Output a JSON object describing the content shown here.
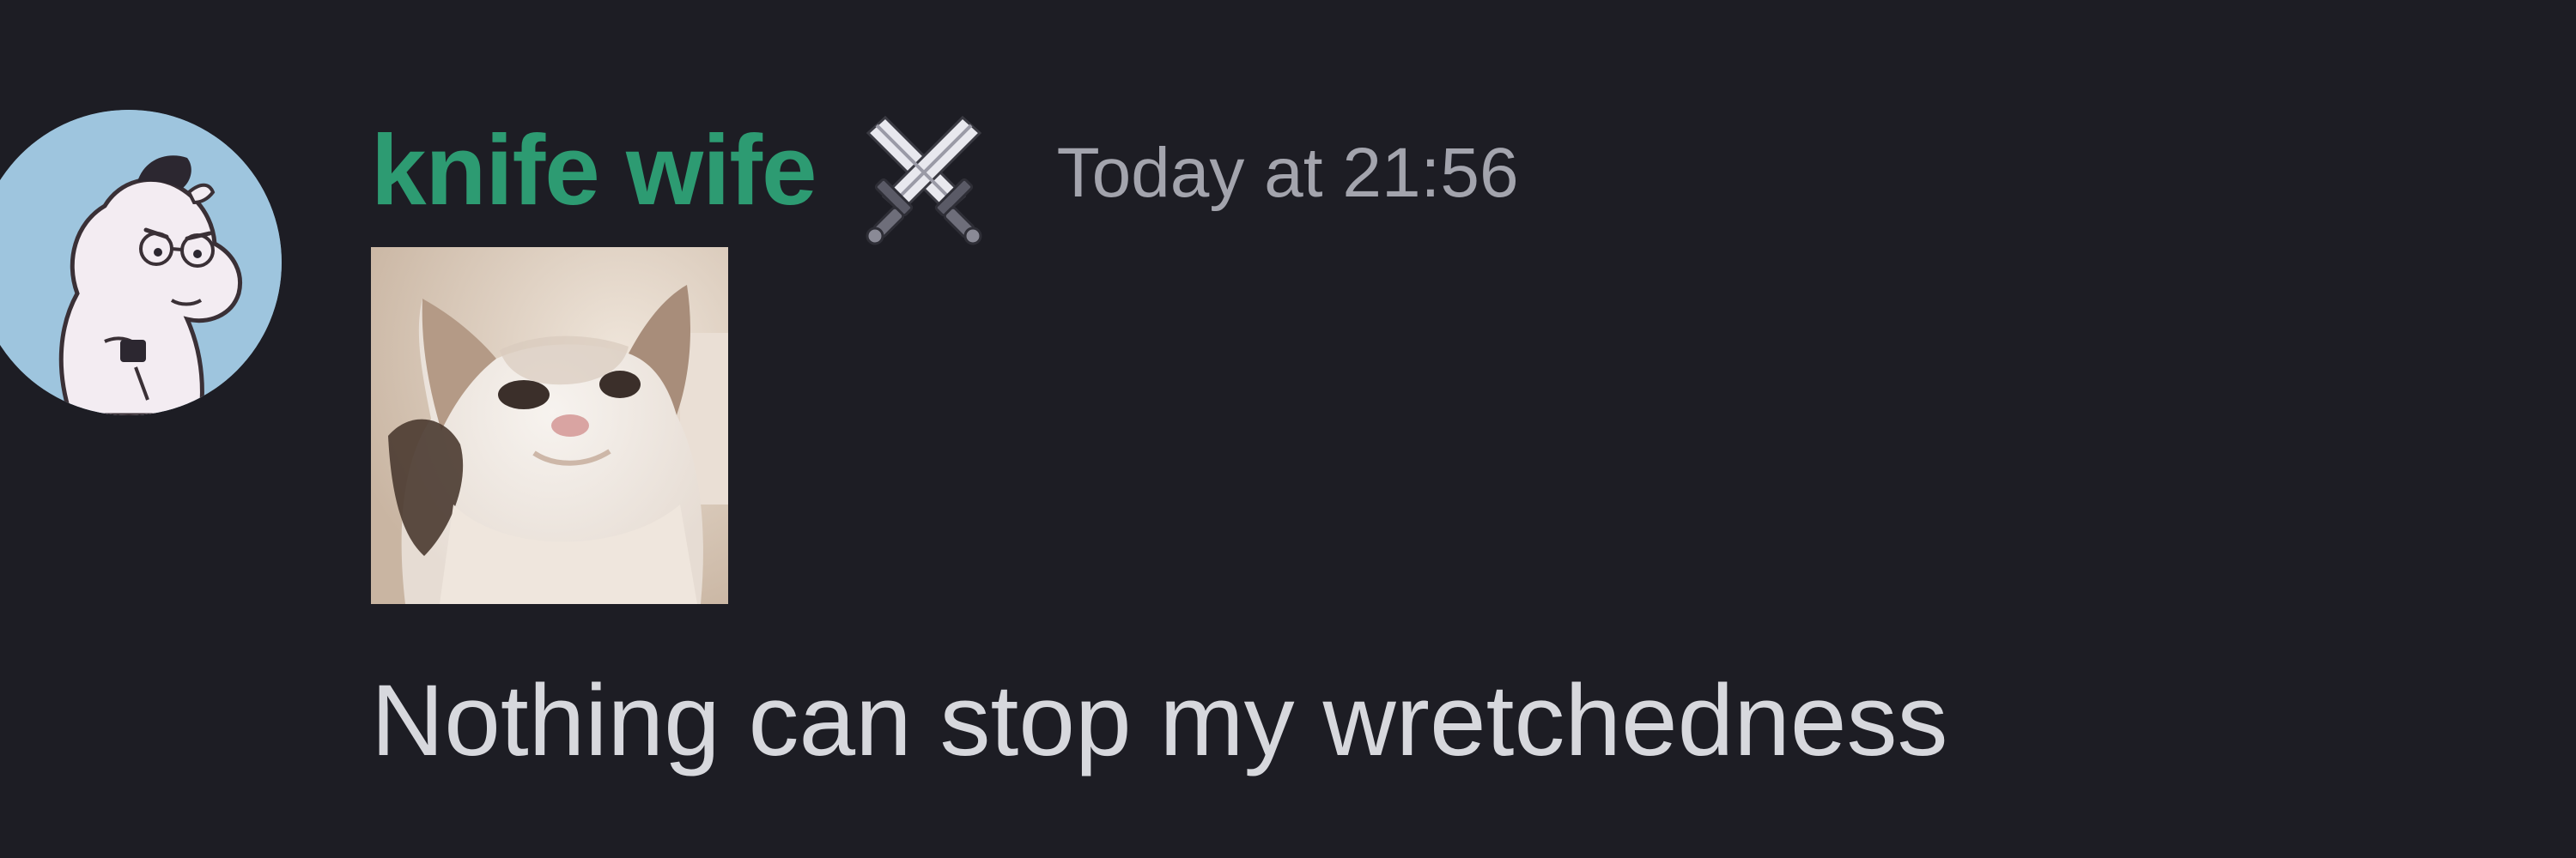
{
  "message": {
    "author": {
      "name": "knife wife",
      "name_color": "#2d9b72",
      "avatar_icon": "moomin-character-avatar",
      "role_icon": "crossed-swords-icon"
    },
    "timestamp": "Today at 21:56",
    "attachment": {
      "type": "image",
      "subject": "cat-image"
    },
    "text": "Nothing can stop my wretchedness"
  },
  "theme": {
    "background": "#1d1d24",
    "timestamp_color": "#a3a4ad",
    "text_color": "#d7d8dd"
  }
}
